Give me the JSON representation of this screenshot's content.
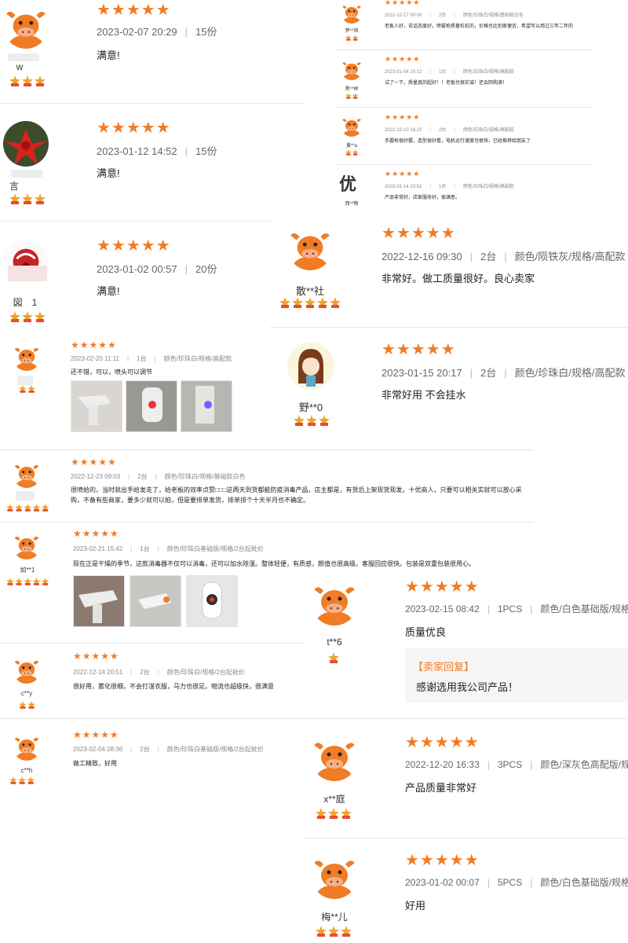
{
  "colors": {
    "star": "#f07c25",
    "badge": "#f2a12b",
    "cow": "#f07c25"
  },
  "stars": "★★★★★",
  "sep": "|",
  "reviews": [
    {
      "user": "w",
      "date": "2023-02-07 20:29",
      "qty": "15份",
      "text": "满意!",
      "avatar": "cow-avatar-icon"
    },
    {
      "user": "言",
      "date": "2023-01-12 14:52",
      "qty": "15份",
      "text": "满意!",
      "avatar": "red-flower-avatar"
    },
    {
      "user": "図　1",
      "date": "2023-01-02 00:57",
      "qty": "20份",
      "text": "满意!",
      "avatar": "red-object-avatar"
    },
    {
      "user": "",
      "date": "2023-02-20 11:11",
      "qty": "1台",
      "spec": "颜色/珍珠白/规格/高配款",
      "text": "还不错，可以，喷头可以调节"
    },
    {
      "user": "",
      "date": "2022-12-23 09:03",
      "qty": "2台",
      "spec": "颜色/珍珠白/规格/基础款白色",
      "text": "很喷给的，当时就出手给发走了，给老板的效率点赞□□□这两天到货都能防疫消毒产品，店主都是，有货后上架现货现发。十优商人，只要可以相关实就可以放心采购，不备有些商家，要多少就可以拍，但是要排单发货，排单排个十天半月也不确定。"
    },
    {
      "user": "如**1",
      "date": "2023-02-21 15:42",
      "qty": "1台",
      "spec": "颜色/珍珠白基础版/规格/2台起批价",
      "text": "现在正是干燥的季节，这款消毒器不仅可以消毒，还可以加水除湿。整体轻便，有质感，颜值也很高级。客服回应很快。包装是双重包装很用心。"
    },
    {
      "user": "c**y",
      "date": "2022-12-14 20:51",
      "qty": "2台",
      "spec": "颜色/珍珠白/规格/2台起批价",
      "text": "很好用，雾化很细，不会打湿衣服，马力也很足。物流也超级快，很满意"
    },
    {
      "user": "c**h",
      "date": "2023-02-04 08:36",
      "qty": "2台",
      "spec": "颜色/珍珠白基础版/规格/2台起批价",
      "text": "做工精致，好用"
    },
    {
      "user": "梦**琪",
      "date": "2022-12-17 00:00",
      "qty": "2台",
      "spec": "颜色/珍珠白/规格/基础款白色",
      "text": "老板人好，说话态度好，喷雾枪质量杠杠的，价格也比别家便宜，希望可以用过三年二年的"
    },
    {
      "user": "黑**林",
      "date": "2023-01-04 15:12",
      "qty": "1台",
      "spec": "颜色/珍珠白/规格/高配款",
      "text": "试了一下，质量真的超好！！老板也很实诚！还会回购滴！"
    },
    {
      "user": "黄**a",
      "date": "2022-12-10 16:23",
      "qty": "2台",
      "spec": "颜色/珍珠白/规格/高配款",
      "text": "手握枪很好握，造型很好看，电机运行速度也很快，已经推荐给朋友了"
    },
    {
      "user": "西**物",
      "date": "2023-01-14 10:51",
      "qty": "1台",
      "spec": "颜色/珍珠白/规格/高配款",
      "text": "产品非常好，店家服务好，很满意。",
      "avatar_text": "优"
    },
    {
      "user": "散**社",
      "date": "2022-12-16 09:30",
      "qty": "2台",
      "spec": "颜色/陨铁灰/规格/高配款",
      "text": "非常好。做工质量很好。良心卖家"
    },
    {
      "user": "野**0",
      "date": "2023-01-15 20:17",
      "qty": "2台",
      "spec": "颜色/珍珠白/规格/高配款",
      "text": "非常好用 不会挂水"
    },
    {
      "user": "t**6",
      "date": "2023-02-15 08:42",
      "qty": "1PCS",
      "spec": "颜色/白色基础版/规格/2台起批价",
      "text": "质量优良",
      "reply_title": "【卖家回复】",
      "reply_text": "感谢选用我公司产品！"
    },
    {
      "user": "x**庭",
      "date": "2022-12-20 16:33",
      "qty": "3PCS",
      "spec": "颜色/深灰色高配版/规格/2台起批价",
      "text": "产品质量非常好"
    },
    {
      "user": "梅**儿",
      "date": "2023-01-02 00:07",
      "qty": "5PCS",
      "spec": "颜色/白色基础版/规格/2台起批价",
      "text": "好用"
    }
  ]
}
